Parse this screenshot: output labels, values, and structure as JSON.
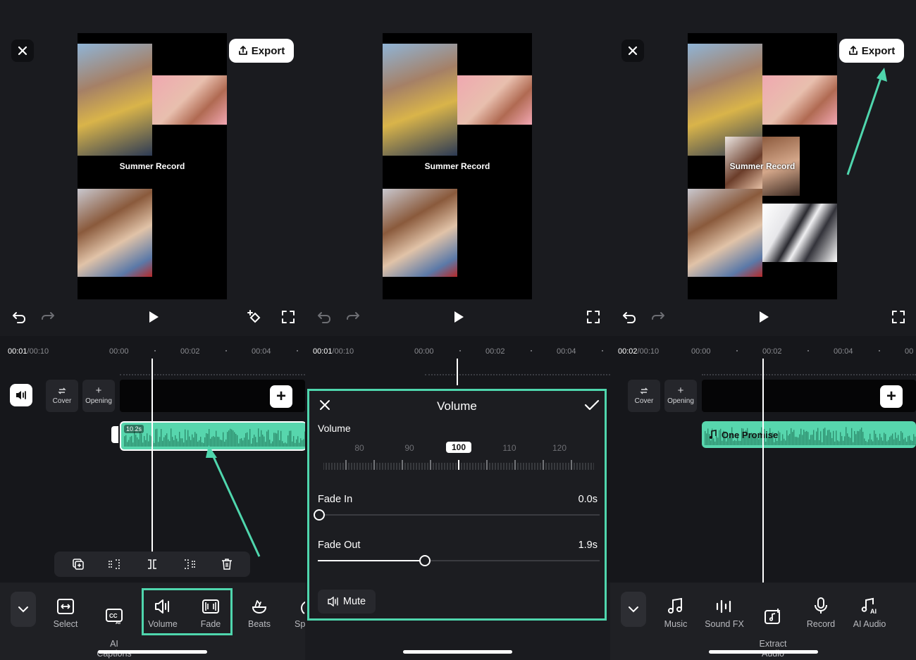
{
  "panels": [
    {
      "preview": {
        "caption": "Summer Record",
        "export_label": "Export"
      },
      "timeline": {
        "current_time": "00:01",
        "total_time": "/00:10",
        "ticks": [
          "00:00",
          "00:02",
          "00:04"
        ],
        "cover_label": "Cover",
        "opening_label": "Opening",
        "clip_duration": "10.2s"
      },
      "toolbar": [
        {
          "label": "Select",
          "icon": "select-icon"
        },
        {
          "label": "AI\nCaptions",
          "icon": "ai-captions-icon"
        },
        {
          "label": "Volume",
          "icon": "volume-icon"
        },
        {
          "label": "Fade",
          "icon": "fade-icon"
        },
        {
          "label": "Beats",
          "icon": "beats-icon"
        },
        {
          "label": "Sp",
          "icon": "speed-icon"
        }
      ]
    },
    {
      "preview": {
        "caption": "Summer Record"
      },
      "timeline": {
        "current_time": "00:01",
        "total_time": "/00:10",
        "ticks": [
          "00:00",
          "00:02",
          "00:04"
        ]
      },
      "volume_dialog": {
        "title": "Volume",
        "volume_label": "Volume",
        "scale": [
          "80",
          "90",
          "100",
          "110",
          "120"
        ],
        "selected": "100",
        "selected_value": 100,
        "fade_in_label": "Fade In",
        "fade_in_value": "0.0s",
        "fade_in_fraction": 0.0,
        "fade_out_label": "Fade Out",
        "fade_out_value": "1.9s",
        "fade_out_fraction": 0.38,
        "mute_label": "Mute"
      }
    },
    {
      "preview": {
        "caption": "Summer Record",
        "export_label": "Export"
      },
      "timeline": {
        "current_time": "00:02",
        "total_time": "/00:10",
        "ticks": [
          "00:00",
          "00:02",
          "00:04",
          "00"
        ],
        "cover_label": "Cover",
        "opening_label": "Opening",
        "audio_title": "One Promise"
      },
      "toolbar": [
        {
          "label": "Music",
          "icon": "music-icon"
        },
        {
          "label": "Sound FX",
          "icon": "sound-fx-icon"
        },
        {
          "label": "Extract\nAudio",
          "icon": "extract-audio-icon"
        },
        {
          "label": "Record",
          "icon": "microphone-icon"
        },
        {
          "label": "AI Audio",
          "icon": "ai-audio-icon"
        }
      ]
    }
  ],
  "colors": {
    "accent": "#4fd6ad",
    "audio_clip": "#57d6ad",
    "background": "#1a1b1f"
  }
}
